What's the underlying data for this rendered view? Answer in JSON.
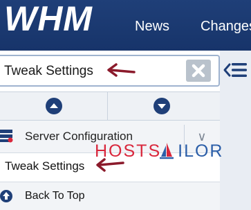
{
  "header": {
    "logo_text": "WHM",
    "nav": [
      "News",
      "Changes"
    ]
  },
  "search": {
    "value": "Tweak Settings",
    "clear_icon": "x-icon",
    "collapse_icon": "collapse-menu-icon"
  },
  "scroll": {
    "up_icon": "chevron-up-circle-icon",
    "down_icon": "chevron-down-circle-icon"
  },
  "section": {
    "label": "Server Configuration",
    "icon": "server-config-icon",
    "toggle": "∨"
  },
  "result": {
    "label": "Tweak Settings"
  },
  "back_to_top": {
    "label": "Back To Top",
    "icon": "arrow-up-circle-icon"
  },
  "watermark": {
    "part1": "HOSTS",
    "part2": "ILOR"
  },
  "colors": {
    "header_bg": "#1f3f78",
    "annotation_arrow": "#8b1a2b",
    "brand_red": "#d9273c",
    "brand_blue": "#2b5ea8"
  }
}
